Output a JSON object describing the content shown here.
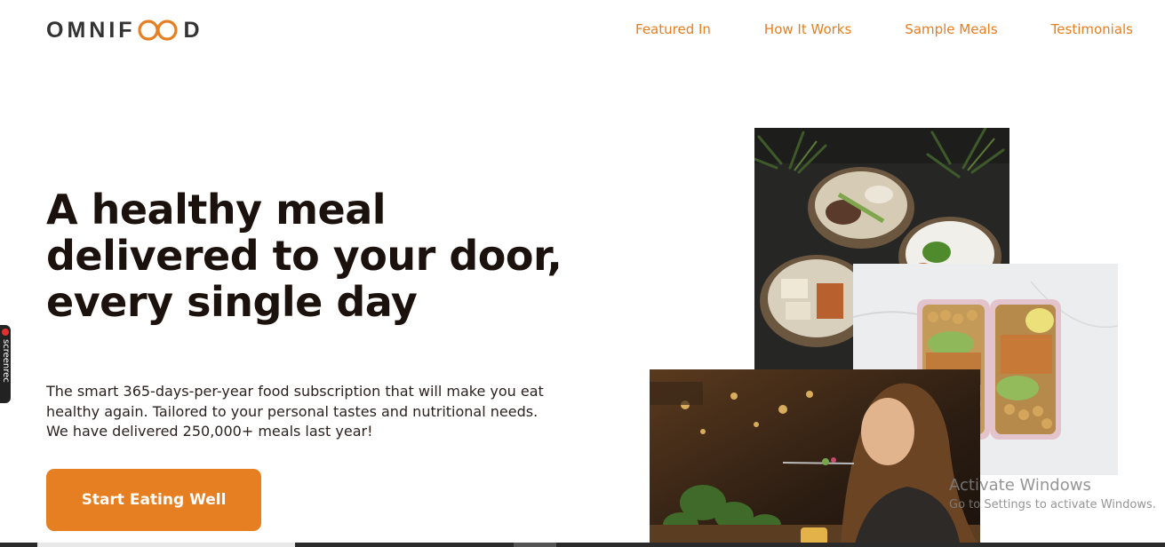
{
  "header": {
    "logo_prefix": "OMNIF",
    "logo_suffix": "D",
    "nav": [
      {
        "label": "Featured In"
      },
      {
        "label": "How It Works"
      },
      {
        "label": "Sample Meals"
      },
      {
        "label": "Testimonials"
      }
    ]
  },
  "hero": {
    "title_lines": [
      "A healthy meal",
      "delivered to your door,",
      "every single day"
    ],
    "description_lines": [
      "The smart 365-days-per-year food subscription that will make you eat",
      "healthy again. Tailored to your personal tastes and nutritional needs.",
      "We have delivered 250,000+ meals last year!"
    ],
    "cta_label": "Start Eating Well"
  },
  "overlay": {
    "screenrec_label": "screenrec",
    "activate_title": "Activate Windows",
    "activate_sub": "Go to Settings to activate Windows."
  },
  "colors": {
    "accent": "#e67e22",
    "heading": "#1c120d"
  }
}
